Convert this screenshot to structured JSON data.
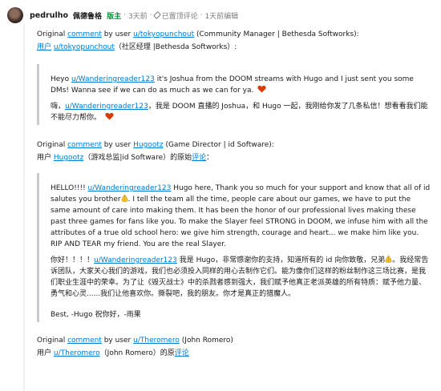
{
  "header": {
    "author": "pedrulho",
    "flair": "佩德鲁格",
    "mod_badge": "版主",
    "age": "3天前",
    "pinned": "已置顶评论",
    "edited": "1天前编辑"
  },
  "block1": {
    "en_pre": "Original ",
    "en_link": "comment",
    "en_mid": " by user ",
    "en_user": "u/tokyopunchout",
    "en_post": " (Community Manager | Bethesda Softworks):",
    "zh_user_word": "用户",
    "zh_user": "u/tokyopunchout",
    "zh_post": "（社区经理 |Bethesda Softworks）:",
    "q_en_pre": "Heyo ",
    "q_en_user": "u/Wanderingreader123",
    "q_en_post": " it's Joshua from the DOOM streams with Hugo and I just sent you some DMs! Wanna see if we can do as much as we can for ya.",
    "q_zh_pre": "嗨，",
    "q_zh_user": "u/Wanderingreader123",
    "q_zh_post": "，我是 DOOM 直播的 Joshua，和 Hugo 一起，我刚给你发了几条私信！想看看我们能不能尽力帮你。"
  },
  "block2": {
    "en_pre": "Original ",
    "en_link": "comment",
    "en_mid": " by user ",
    "en_user": "Hugootz",
    "en_post": " (Game Director | id Software):",
    "zh_pre": "用户 ",
    "zh_user": "Hugootz",
    "zh_mid": "（游戏总监|id Software）的原始",
    "zh_link": "评论",
    "zh_post": "：",
    "q_en_pre": "HELLO!!!! ",
    "q_en_user": "u/Wanderingreader123",
    "q_en_1": " Hugo here, Thank you so much for your support and know that all of id salutes you brother",
    "q_en_2": ". I tell the team all the time, people care about our games, we have to put the same amount of care into making them. It has been the honor of our professional lives making these past three games for fans like you. To make the Slayer feel STRONG in DOOM, we infuse him with all the attributes of a true old school hero: we give him strength, courage and heart... we make him like you. RIP AND TEAR my friend. You are the real Slayer.",
    "q_zh_pre": "你好！！！！",
    "q_zh_user": "u/Wanderingreader123",
    "q_zh_1": " 我是 Hugo，非常感谢你的支持，知道所有的 id 向你致敬，兄弟",
    "q_zh_2": "。我经常告诉团队，大家关心我们的游戏，我们也必须投入同样的用心去制作它们。能为像你们这样的粉丝制作这三场比赛，是我们职业生涯中的荣幸。为了让《毁灭战士》中的杀戮者感到强大，我们赋予他真正老派英雄的所有特质：赋予他力量、勇气和心灵......我们让他喜欢你。撕裂吧，我的朋友。你才是真正的猎魔人。",
    "sign": "Best, -Hugo   祝你好，-雨果"
  },
  "block3": {
    "en_pre": "Original ",
    "en_link": "comment",
    "en_mid": " by user ",
    "en_user": "u/Theromero",
    "en_post": " (John Romero)",
    "zh_pre": "用户 ",
    "zh_user": "u/Theromero",
    "zh_mid": "（John Romero）的原",
    "zh_link": "评论"
  },
  "colors": {
    "link": "#0079d3",
    "mod": "#0a8f36",
    "heart": "#d93a00",
    "quote_bar": "#c8ccd0"
  },
  "icons": [
    "avatar",
    "pin-icon",
    "heart-icon",
    "raised-hands-icon"
  ]
}
